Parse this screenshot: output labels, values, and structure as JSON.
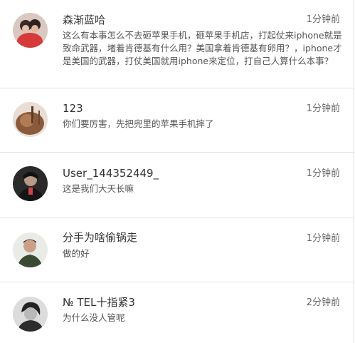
{
  "comments": [
    {
      "user": "森渐蓝哈",
      "time": "1分钟前",
      "text": "这么有本事怎么不去砸苹果手机，砸苹果手机店，打起仗来iphone就是致命武器，堵着肯德基有什么用？美国拿着肯德基有卵用？，iphone才是美国的武器，打仗美国就用iphone来定位，打自己人算什么本事？",
      "avatar": "avatar-couple-red"
    },
    {
      "user": "123",
      "time": "1分钟前",
      "text": "你们要厉害，先把兜里的苹果手机摔了",
      "avatar": "avatar-brown-photo"
    },
    {
      "user": "User_144352449_",
      "time": "1分钟前",
      "text": "这是我们大天长嘛",
      "avatar": "avatar-dark-portrait"
    },
    {
      "user": "分手为啥偷锅走",
      "time": "1分钟前",
      "text": "做的好",
      "avatar": "avatar-man-green"
    },
    {
      "user": "№ TEL十指紧3",
      "time": "2分钟前",
      "text": "为什么没人管呢",
      "avatar": "avatar-bw-portrait"
    }
  ],
  "colors": {
    "background": "#ffffff",
    "separator": "#e2e2e2",
    "name": "#333333",
    "time": "#666666",
    "text": "#555555"
  }
}
